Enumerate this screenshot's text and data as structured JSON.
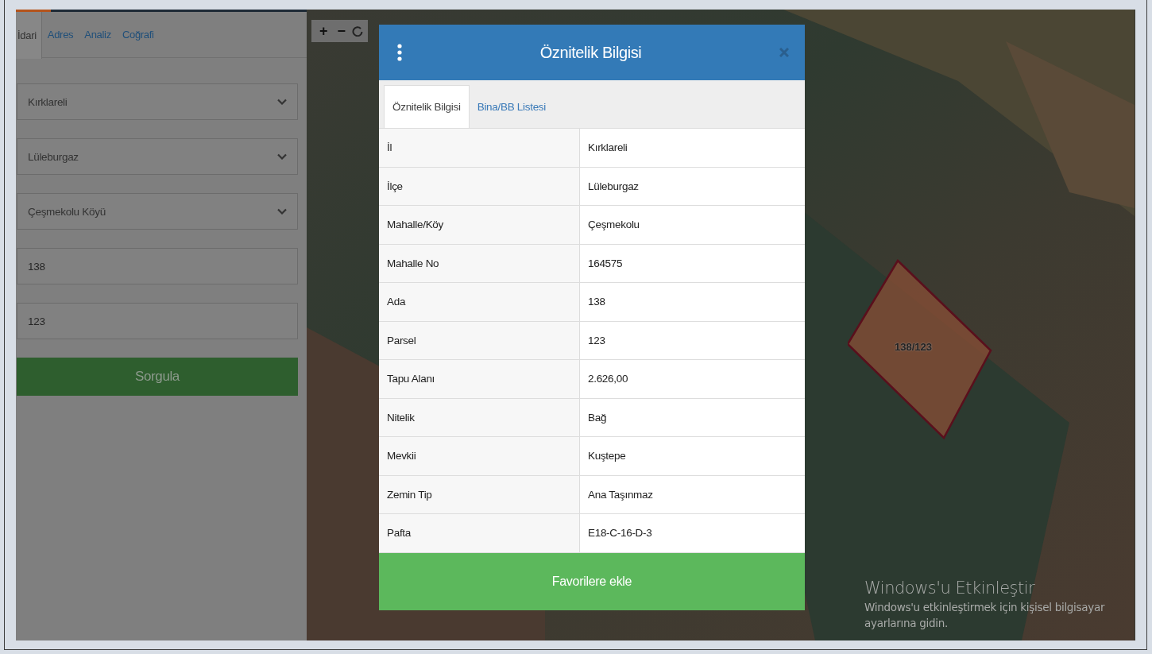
{
  "left_panel": {
    "tabs": [
      {
        "label": "İdari",
        "selected": true
      },
      {
        "label": "Adres",
        "selected": false
      },
      {
        "label": "Analiz",
        "selected": false
      },
      {
        "label": "Coğrafi",
        "selected": false
      }
    ],
    "fields": [
      {
        "kind": "select",
        "value": "Kırklareli"
      },
      {
        "kind": "select",
        "value": "Lüleburgaz"
      },
      {
        "kind": "select",
        "value": "Çeşmekolu Köyü"
      },
      {
        "kind": "input",
        "value": "138"
      },
      {
        "kind": "input",
        "value": "123"
      }
    ],
    "query_button": "Sorgula"
  },
  "map": {
    "controls": [
      "+",
      "−"
    ],
    "parcel_label": "138/123",
    "activation_notice": {
      "title": "Windows'u Etkinleştir",
      "message": "Windows'u etkinleştirmek için kişisel bilgisayar ayarlarına gidin."
    }
  },
  "dialog": {
    "title": "Öznitelik Bilgisi",
    "tabs": [
      {
        "label": "Öznitelik Bilgisi",
        "selected": true
      },
      {
        "label": "Bina/BB Listesi",
        "selected": false
      }
    ],
    "rows": [
      {
        "label": "İl",
        "value": "Kırklareli"
      },
      {
        "label": "İlçe",
        "value": "Lüleburgaz"
      },
      {
        "label": "Mahalle/Köy",
        "value": "Çeşmekolu"
      },
      {
        "label": "Mahalle No",
        "value": "164575"
      },
      {
        "label": "Ada",
        "value": "138"
      },
      {
        "label": "Parsel",
        "value": "123"
      },
      {
        "label": "Tapu Alanı",
        "value": "2.626,00"
      },
      {
        "label": "Nitelik",
        "value": "Bağ"
      },
      {
        "label": "Mevkii",
        "value": "Kuştepe"
      },
      {
        "label": "Zemin Tip",
        "value": "Ana Taşınmaz"
      },
      {
        "label": "Pafta",
        "value": "E18-C-16-D-3"
      }
    ],
    "footer_button": "Favorilere ekle"
  }
}
